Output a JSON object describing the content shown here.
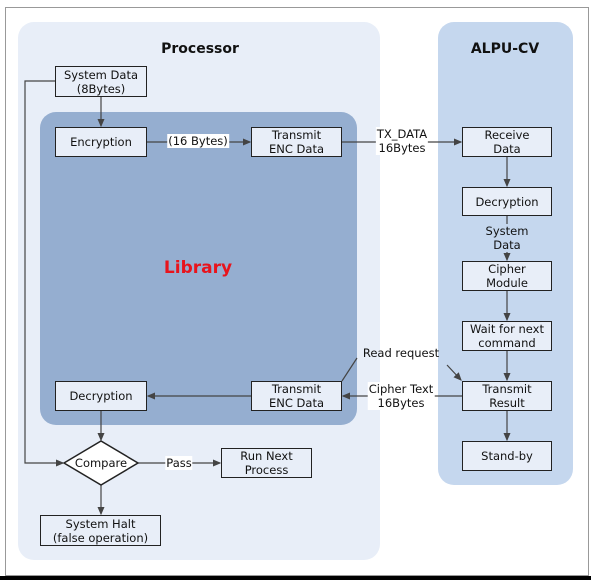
{
  "colors": {
    "processor_panel": "#e8eef8",
    "library_panel": "#95aed0",
    "alpu_panel": "#c5d7ee",
    "library_title": "#e8141c"
  },
  "processor": {
    "title": "Processor",
    "system_data": "System Data\n(8Bytes)",
    "encryption": "Encryption",
    "transmit_enc_top": "Transmit\nENC Data",
    "decryption": "Decryption",
    "transmit_enc_bottom": "Transmit\nENC Data",
    "compare": "Compare",
    "run_next": "Run Next\nProcess",
    "system_halt": "System Halt\n(false operation)"
  },
  "library": {
    "title": "Library"
  },
  "alpu": {
    "title": "ALPU-CV",
    "receive": "Receive\nData",
    "decryption": "Decryption",
    "cipher_module": "Cipher\nModule",
    "wait": "Wait for next\ncommand",
    "transmit_result": "Transmit\nResult",
    "standby": "Stand-by"
  },
  "labels": {
    "sixteen_bytes": "(16 Bytes)",
    "tx_data": "TX_DATA\n16Bytes",
    "system_data": "System\nData",
    "read_request": "Read request",
    "cipher_text": "Cipher Text\n16Bytes",
    "pass": "Pass"
  }
}
